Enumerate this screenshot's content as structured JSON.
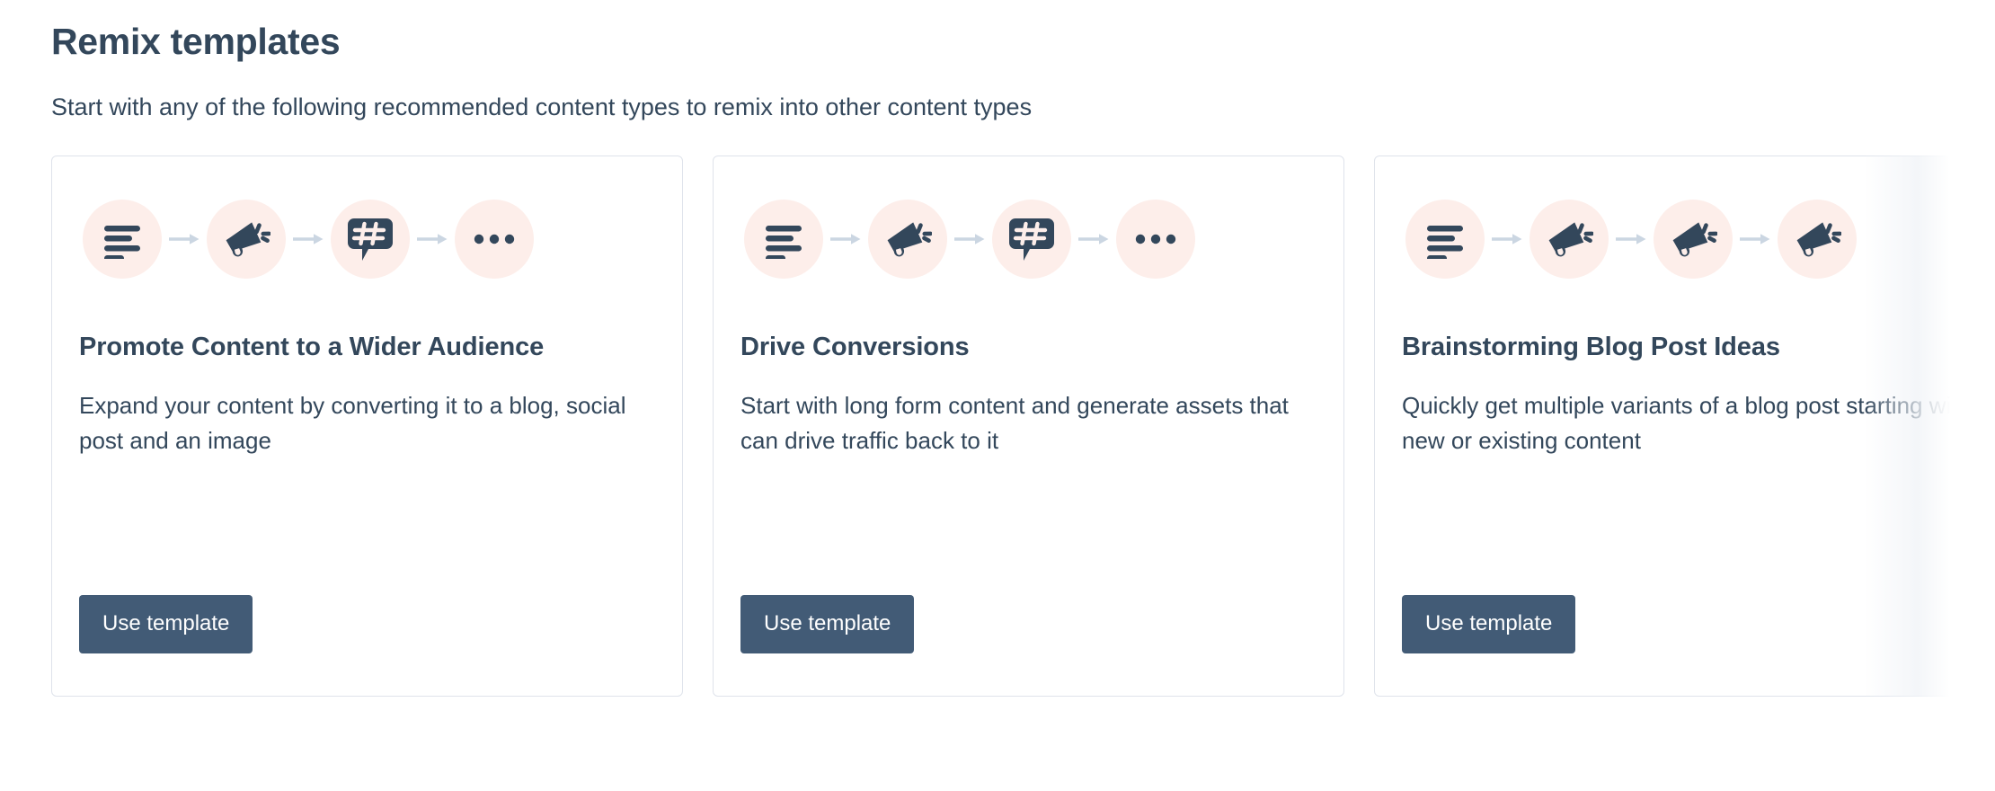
{
  "header": {
    "title": "Remix templates",
    "subtitle": "Start with any of the following recommended content types to remix into other content types"
  },
  "colors": {
    "text": "#33475b",
    "card_border": "#dfe3eb",
    "icon_bubble": "#fdeeea",
    "icon_glyph": "#33475b",
    "arrow": "#cbd6e2",
    "button_bg": "#425b76",
    "button_text": "#ffffff",
    "page_bg": "#ffffff"
  },
  "cards": [
    {
      "title": "Promote Content to a Wider Audience",
      "description": "Expand your content by converting it to a blog, social post and an image",
      "button_label": "Use template",
      "flow": [
        "text-lines-icon",
        "megaphone-icon",
        "hashtag-speech-bubble-icon",
        "ellipsis-icon"
      ]
    },
    {
      "title": "Drive Conversions",
      "description": "Start with long form content and generate assets that can drive traffic back to it",
      "button_label": "Use template",
      "flow": [
        "text-lines-icon",
        "megaphone-icon",
        "hashtag-speech-bubble-icon",
        "ellipsis-icon"
      ]
    },
    {
      "title": "Brainstorming Blog Post Ideas",
      "description": "Quickly get multiple variants of a blog post starting with new or existing content",
      "button_label": "Use template",
      "flow": [
        "text-lines-icon",
        "megaphone-icon",
        "megaphone-icon",
        "megaphone-icon"
      ]
    }
  ]
}
